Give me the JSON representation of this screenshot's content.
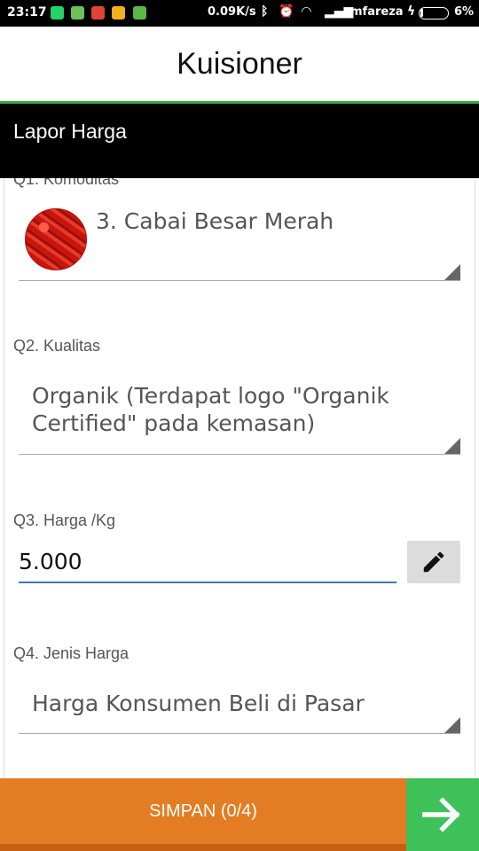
{
  "status_bar": {
    "time": "23:17",
    "net_speed": "0.09K/s",
    "carrier": "mfareza",
    "battery": "6%",
    "app_icons": [
      "whatsapp-icon",
      "phone-icon",
      "gmail-icon",
      "camera-icon",
      "android-icon"
    ]
  },
  "header": {
    "title": "Kuisioner"
  },
  "section": {
    "title": "Lapor Harga"
  },
  "questions": {
    "q1": {
      "label": "Q1. Komoditas",
      "value": "3. Cabai Besar Merah",
      "image": "red-chili-image"
    },
    "q2": {
      "label": "Q2. Kualitas",
      "value_line1": "Organik (Terdapat logo \"Organik",
      "value_line2": "Certified\" pada kemasan)"
    },
    "q3": {
      "label": "Q3. Harga /Kg",
      "value": "5.000",
      "edit_icon": "pencil-icon"
    },
    "q4": {
      "label": "Q4. Jenis Harga",
      "value": "Harga Konsumen Beli di Pasar"
    }
  },
  "footer": {
    "save_label": "SIMPAN (0/4)",
    "next_icon": "arrow-right-icon"
  },
  "colors": {
    "accent_green": "#3fa64a",
    "save_orange": "#e37c22",
    "next_green": "#3fc15a",
    "input_blue": "#3f76b5"
  }
}
